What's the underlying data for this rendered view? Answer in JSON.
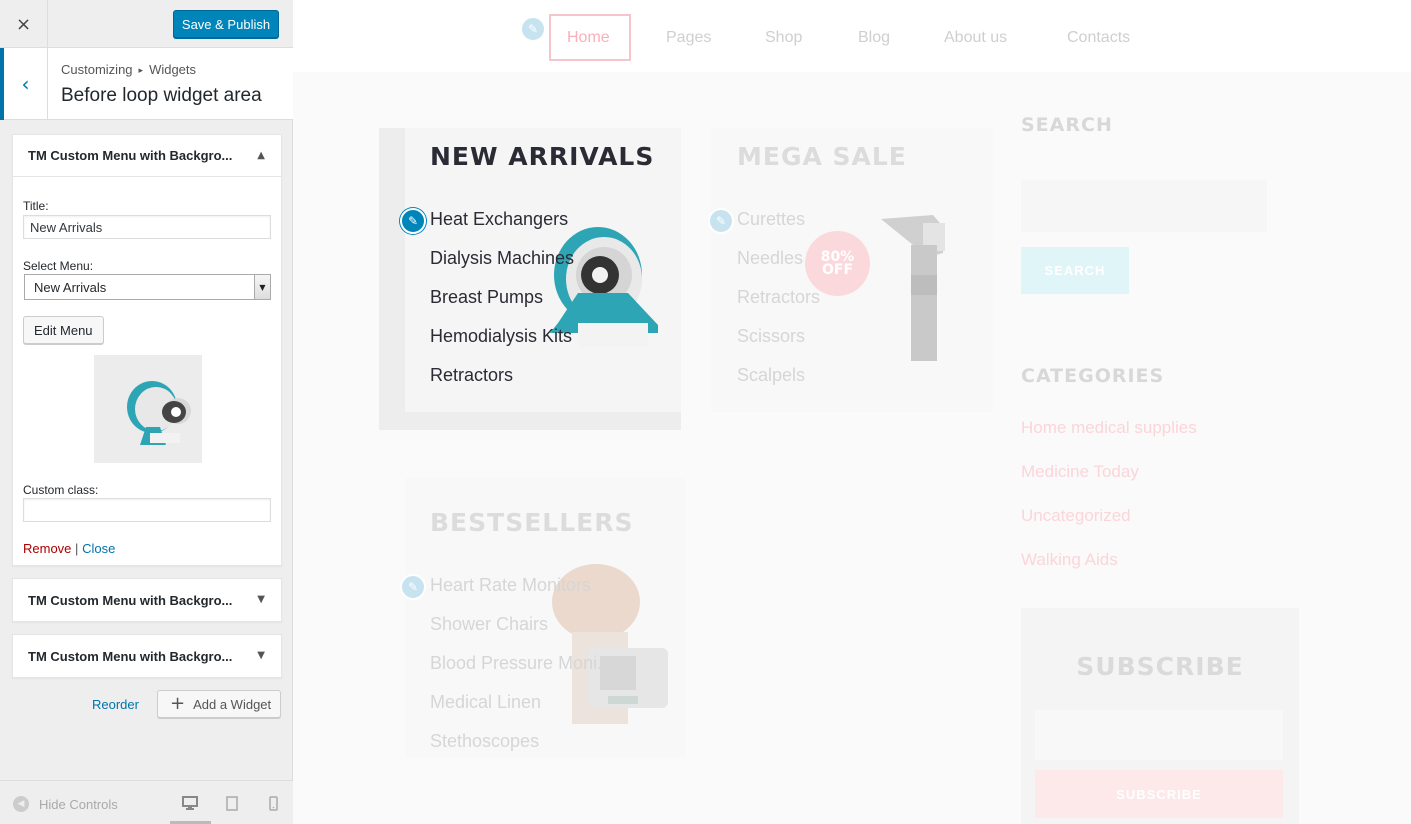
{
  "header": {
    "close_label": "×",
    "save_label": "Save & Publish"
  },
  "section": {
    "back_label": "‹",
    "breadcrumb_root": "Customizing",
    "breadcrumb_sep": "▸",
    "breadcrumb_leaf": "Widgets",
    "title": "Before loop widget area"
  },
  "widgets": [
    {
      "title": "TM Custom Menu with Backgro...",
      "arrow": "▲"
    },
    {
      "title": "TM Custom Menu with Backgro...",
      "arrow": "▼"
    },
    {
      "title": "TM Custom Menu with Backgro...",
      "arrow": "▼"
    }
  ],
  "form": {
    "title_label": "Title:",
    "title_value": "New Arrivals",
    "menu_label": "Select Menu:",
    "menu_value": "New Arrivals",
    "edit_menu_label": "Edit Menu",
    "custom_class_label": "Custom class:",
    "custom_class_value": "",
    "remove_label": "Remove",
    "link_sep": "|",
    "close_label": "Close"
  },
  "panel_actions": {
    "reorder_label": "Reorder",
    "add_widget_label": "Add a Widget"
  },
  "footer": {
    "hide_controls_label": "Hide Controls"
  },
  "preview": {
    "nav": [
      "Home",
      "Pages",
      "Shop",
      "Blog",
      "About us",
      "Contacts"
    ],
    "new_arrivals": {
      "title": "NEW ARRIVALS",
      "links": [
        "Heat Exchangers",
        "Dialysis Machines",
        "Breast Pumps",
        "Hemodialysis Kits",
        "Retractors"
      ]
    },
    "mega_sale": {
      "title": "MEGA SALE",
      "links": [
        "Curettes",
        "Needles",
        "Retractors",
        "Scissors",
        "Scalpels"
      ],
      "badge_line1": "80%",
      "badge_line2": "OFF"
    },
    "bestsellers": {
      "title": "BESTSELLERS",
      "links": [
        "Heart Rate Monitors",
        "Shower Chairs",
        "Blood Pressure Moni...",
        "Medical Linen",
        "Stethoscopes"
      ]
    },
    "sidebar": {
      "search_title": "SEARCH",
      "search_button": "SEARCH",
      "categories_title": "CATEGORIES",
      "categories": [
        "Home medical supplies",
        "Medicine Today",
        "Uncategorized",
        "Walking Aids"
      ],
      "subscribe_title": "SUBSCRIBE",
      "subscribe_button": "SUBSCRIBE"
    }
  },
  "colors": {
    "primary": "#0085ba",
    "link": "#0073aa",
    "remove": "#aa0000",
    "accent_pink": "#f9b0b8",
    "teal": "#2ea5b5"
  }
}
